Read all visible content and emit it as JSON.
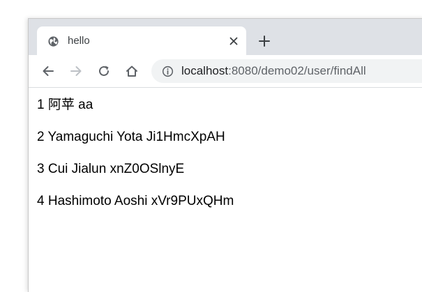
{
  "tab": {
    "title": "hello",
    "favicon": "globe-icon"
  },
  "address_bar": {
    "host": "localhost",
    "path": ":8080/demo02/user/findAll",
    "security_icon": "info-icon"
  },
  "toolbar": {
    "icons": [
      "back-arrow-icon",
      "forward-arrow-icon",
      "reload-icon",
      "home-icon"
    ]
  },
  "users": [
    {
      "id": "1",
      "name": "阿苹",
      "value": "aa"
    },
    {
      "id": "2",
      "name": "Yamaguchi Yota",
      "value": "Ji1HmcXpAH"
    },
    {
      "id": "3",
      "name": "Cui Jialun",
      "value": "xnZ0OSlnyE"
    },
    {
      "id": "4",
      "name": "Hashimoto Aoshi",
      "value": "xVr9PUxQHm"
    }
  ],
  "colors": {
    "tabstrip": "#dee1e6",
    "omnibox": "#f1f3f4",
    "icon": "#5f6368",
    "disabled_icon": "#bdc1c6"
  }
}
